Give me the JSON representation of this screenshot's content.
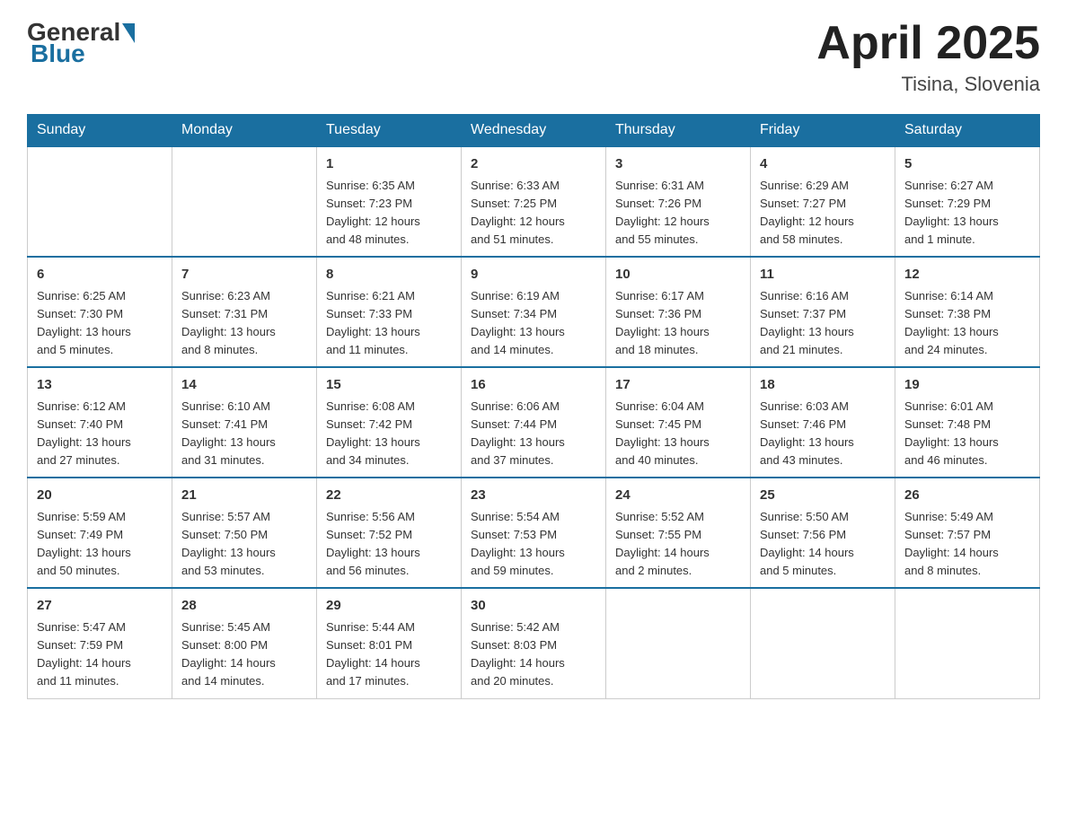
{
  "header": {
    "logo": {
      "general": "General",
      "blue": "Blue"
    },
    "title": "April 2025",
    "location": "Tisina, Slovenia"
  },
  "weekdays": [
    "Sunday",
    "Monday",
    "Tuesday",
    "Wednesday",
    "Thursday",
    "Friday",
    "Saturday"
  ],
  "weeks": [
    [
      {
        "day": "",
        "info": ""
      },
      {
        "day": "",
        "info": ""
      },
      {
        "day": "1",
        "info": "Sunrise: 6:35 AM\nSunset: 7:23 PM\nDaylight: 12 hours\nand 48 minutes."
      },
      {
        "day": "2",
        "info": "Sunrise: 6:33 AM\nSunset: 7:25 PM\nDaylight: 12 hours\nand 51 minutes."
      },
      {
        "day": "3",
        "info": "Sunrise: 6:31 AM\nSunset: 7:26 PM\nDaylight: 12 hours\nand 55 minutes."
      },
      {
        "day": "4",
        "info": "Sunrise: 6:29 AM\nSunset: 7:27 PM\nDaylight: 12 hours\nand 58 minutes."
      },
      {
        "day": "5",
        "info": "Sunrise: 6:27 AM\nSunset: 7:29 PM\nDaylight: 13 hours\nand 1 minute."
      }
    ],
    [
      {
        "day": "6",
        "info": "Sunrise: 6:25 AM\nSunset: 7:30 PM\nDaylight: 13 hours\nand 5 minutes."
      },
      {
        "day": "7",
        "info": "Sunrise: 6:23 AM\nSunset: 7:31 PM\nDaylight: 13 hours\nand 8 minutes."
      },
      {
        "day": "8",
        "info": "Sunrise: 6:21 AM\nSunset: 7:33 PM\nDaylight: 13 hours\nand 11 minutes."
      },
      {
        "day": "9",
        "info": "Sunrise: 6:19 AM\nSunset: 7:34 PM\nDaylight: 13 hours\nand 14 minutes."
      },
      {
        "day": "10",
        "info": "Sunrise: 6:17 AM\nSunset: 7:36 PM\nDaylight: 13 hours\nand 18 minutes."
      },
      {
        "day": "11",
        "info": "Sunrise: 6:16 AM\nSunset: 7:37 PM\nDaylight: 13 hours\nand 21 minutes."
      },
      {
        "day": "12",
        "info": "Sunrise: 6:14 AM\nSunset: 7:38 PM\nDaylight: 13 hours\nand 24 minutes."
      }
    ],
    [
      {
        "day": "13",
        "info": "Sunrise: 6:12 AM\nSunset: 7:40 PM\nDaylight: 13 hours\nand 27 minutes."
      },
      {
        "day": "14",
        "info": "Sunrise: 6:10 AM\nSunset: 7:41 PM\nDaylight: 13 hours\nand 31 minutes."
      },
      {
        "day": "15",
        "info": "Sunrise: 6:08 AM\nSunset: 7:42 PM\nDaylight: 13 hours\nand 34 minutes."
      },
      {
        "day": "16",
        "info": "Sunrise: 6:06 AM\nSunset: 7:44 PM\nDaylight: 13 hours\nand 37 minutes."
      },
      {
        "day": "17",
        "info": "Sunrise: 6:04 AM\nSunset: 7:45 PM\nDaylight: 13 hours\nand 40 minutes."
      },
      {
        "day": "18",
        "info": "Sunrise: 6:03 AM\nSunset: 7:46 PM\nDaylight: 13 hours\nand 43 minutes."
      },
      {
        "day": "19",
        "info": "Sunrise: 6:01 AM\nSunset: 7:48 PM\nDaylight: 13 hours\nand 46 minutes."
      }
    ],
    [
      {
        "day": "20",
        "info": "Sunrise: 5:59 AM\nSunset: 7:49 PM\nDaylight: 13 hours\nand 50 minutes."
      },
      {
        "day": "21",
        "info": "Sunrise: 5:57 AM\nSunset: 7:50 PM\nDaylight: 13 hours\nand 53 minutes."
      },
      {
        "day": "22",
        "info": "Sunrise: 5:56 AM\nSunset: 7:52 PM\nDaylight: 13 hours\nand 56 minutes."
      },
      {
        "day": "23",
        "info": "Sunrise: 5:54 AM\nSunset: 7:53 PM\nDaylight: 13 hours\nand 59 minutes."
      },
      {
        "day": "24",
        "info": "Sunrise: 5:52 AM\nSunset: 7:55 PM\nDaylight: 14 hours\nand 2 minutes."
      },
      {
        "day": "25",
        "info": "Sunrise: 5:50 AM\nSunset: 7:56 PM\nDaylight: 14 hours\nand 5 minutes."
      },
      {
        "day": "26",
        "info": "Sunrise: 5:49 AM\nSunset: 7:57 PM\nDaylight: 14 hours\nand 8 minutes."
      }
    ],
    [
      {
        "day": "27",
        "info": "Sunrise: 5:47 AM\nSunset: 7:59 PM\nDaylight: 14 hours\nand 11 minutes."
      },
      {
        "day": "28",
        "info": "Sunrise: 5:45 AM\nSunset: 8:00 PM\nDaylight: 14 hours\nand 14 minutes."
      },
      {
        "day": "29",
        "info": "Sunrise: 5:44 AM\nSunset: 8:01 PM\nDaylight: 14 hours\nand 17 minutes."
      },
      {
        "day": "30",
        "info": "Sunrise: 5:42 AM\nSunset: 8:03 PM\nDaylight: 14 hours\nand 20 minutes."
      },
      {
        "day": "",
        "info": ""
      },
      {
        "day": "",
        "info": ""
      },
      {
        "day": "",
        "info": ""
      }
    ]
  ]
}
